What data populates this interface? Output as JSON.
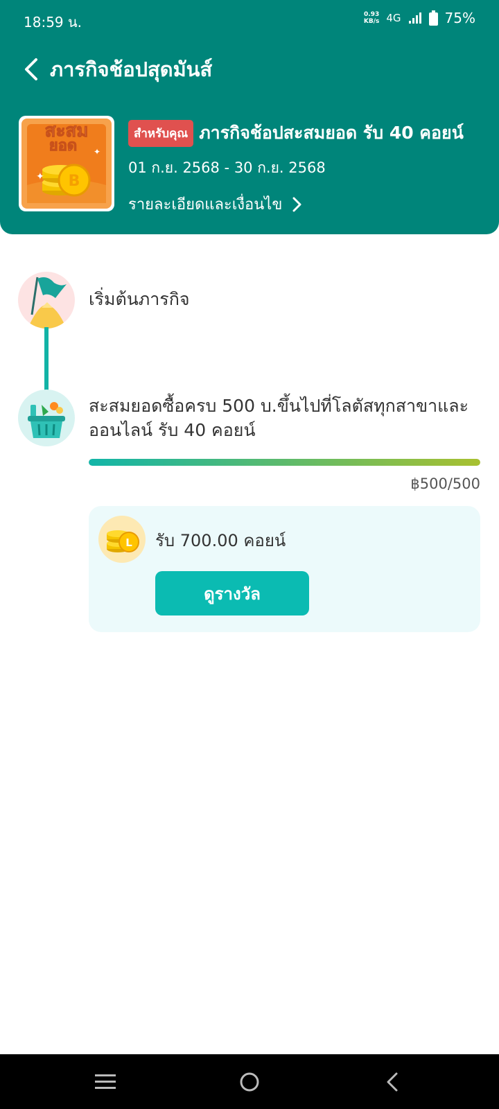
{
  "status_bar": {
    "time": "18:59 น.",
    "net_speed_value": "0.93",
    "net_speed_unit": "KB/s",
    "network": "4G",
    "battery": "75%"
  },
  "header": {
    "title": "ภารกิจช้อปสุดมันส์",
    "back_icon": "chevron-left-icon"
  },
  "mission": {
    "badge": "สำหรับคุณ",
    "title": "ภารกิจช้อปสะสมยอด รับ 40 คอยน์",
    "dates": "01 ก.ย. 2568 - 30 ก.ย. 2568",
    "details_link": "รายละเอียดและเงื่อนไข",
    "thumbnail_text_line1": "สะสม",
    "thumbnail_text_line2": "ยอด"
  },
  "steps": [
    {
      "label": "เริ่มต้นภารกิจ",
      "icon": "flag-icon"
    },
    {
      "label": "สะสมยอดซื้อครบ 500 บ.ขึ้นไปที่โลตัสทุกสาขาและออนไลน์ รับ 40 คอยน์",
      "icon": "shopping-basket-icon",
      "progress_text": "฿500/500",
      "progress_fraction": 1.0
    }
  ],
  "reward": {
    "text": "รับ 700.00 คอยน์",
    "button_label": "ดูรางวัล",
    "icon": "coin-stack-icon"
  },
  "nav": {
    "menu_icon": "menu-icon",
    "home_icon": "home-circle-icon",
    "back_icon": "back-triangle-icon"
  },
  "colors": {
    "primary": "#00857a",
    "badge": "#e0514f",
    "button": "#0bbbb2",
    "progress_start": "#12b5a8",
    "progress_end": "#a8c030"
  }
}
